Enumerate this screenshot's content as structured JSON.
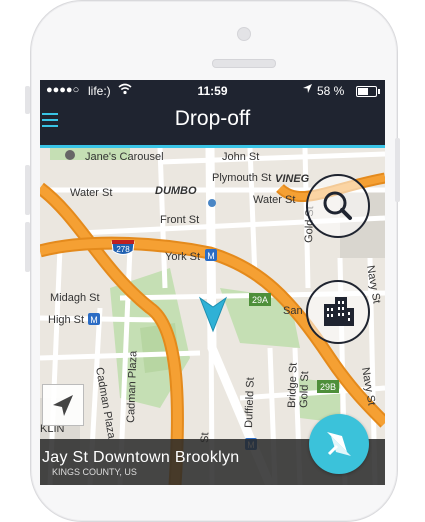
{
  "status_bar": {
    "signal": "●●●●○",
    "carrier": "life:)",
    "time": "11:59",
    "battery_percent": "58 %",
    "battery_level": 0.58
  },
  "nav": {
    "title": "Drop-off"
  },
  "map": {
    "labels": {
      "janes_carousel": "Jane's Carousel",
      "john_st": "John St",
      "plymouth_st": "Plymouth St",
      "water_st_left": "Water St",
      "water_st_right": "Water St",
      "dumbo": "DUMBO",
      "vinegar_hill": "VINEG",
      "front_st": "Front St",
      "york_st": "York St",
      "midagh_st": "Midagh St",
      "high_st": "High St",
      "gold_st_top": "Gold St",
      "gold_st_bottom": "Gold St",
      "navy_st_top": "Navy St",
      "navy_st_bottom": "Navy St",
      "sands_st": "San",
      "cadman_plaza": "Cadman Plaza",
      "duffield_st": "Duffield St",
      "bridge_st": "Bridge St",
      "jay_st": "St",
      "nights": "KLIN\nGHTS",
      "shield_278": "278",
      "exit_29a": "29A",
      "exit_29b": "29B",
      "metro": "M",
      "york_station": "F"
    }
  },
  "bottom_card": {
    "place": "Jay St Downtown Brooklyn",
    "region": "KINGS COUNTY, US"
  },
  "colors": {
    "accent": "#39c4e6",
    "nav_bg": "#1f2430",
    "highway": "#f5a033",
    "park": "#c5dfb4",
    "nav_button": "#3bc2da"
  }
}
